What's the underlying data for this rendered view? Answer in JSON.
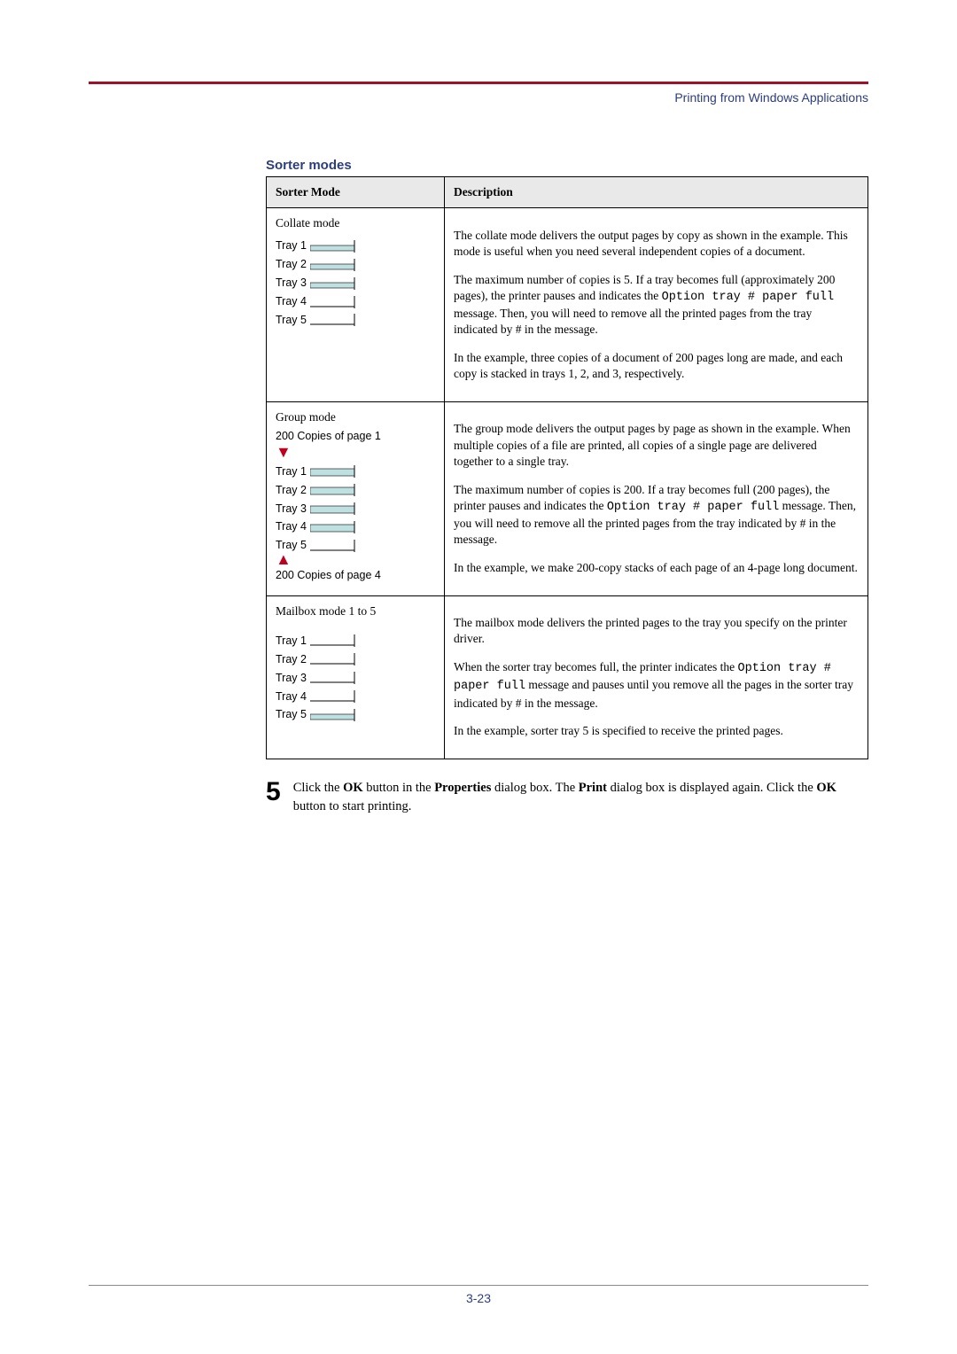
{
  "running_head": "Printing from Windows Applications",
  "section_title": "Sorter modes",
  "table": {
    "head": {
      "mode": "Sorter Mode",
      "desc": "Description"
    },
    "rows": [
      {
        "mode_title": "Collate mode",
        "trays": [
          "Tray 1",
          "Tray 2",
          "Tray 3",
          "Tray 4",
          "Tray 5"
        ],
        "desc": {
          "p1": "The collate mode delivers the output pages by copy as shown in the example. This mode is useful when you need several independent copies of a document.",
          "p2a": "The maximum number of copies is 5. If a tray becomes full (approximately 200 pages), the printer pauses and indicates the ",
          "p2code": "Option tray # paper full",
          "p2b": " message. Then, you will need to remove all the printed pages from the tray indicated by # in the message.",
          "p3": "In the example, three copies of a document of 200 pages long are made, and each copy is stacked in trays 1, 2, and 3, respectively."
        }
      },
      {
        "mode_title": "Group mode",
        "caption_top": "200 Copies of page 1",
        "caption_bot": "200 Copies of page 4",
        "trays": [
          "Tray 1",
          "Tray 2",
          "Tray 3",
          "Tray 4",
          "Tray 5"
        ],
        "desc": {
          "p1": "The group mode delivers the output pages by page as shown in the example. When multiple copies of a file are printed, all copies of a single page are delivered together to a single tray.",
          "p2a": "The maximum number of copies is 200. If a tray becomes full (200 pages), the printer pauses and indicates the ",
          "p2code": "Option tray # paper full",
          "p2b": " message. Then, you will need to remove all the printed pages from the tray indicated by # in the message.",
          "p3": "In the example, we make 200-copy stacks of each page of an 4-page long document."
        }
      },
      {
        "mode_title": "Mailbox mode 1 to 5",
        "trays": [
          "Tray 1",
          "Tray 2",
          "Tray 3",
          "Tray 4",
          "Tray 5"
        ],
        "desc": {
          "p1": "The mailbox mode delivers the printed pages to the tray you specify on the printer driver.",
          "p2a": "When the sorter tray becomes full, the printer indicates the ",
          "p2code": "Option tray # paper full",
          "p2b": " message and pauses until you remove all the pages in the sorter tray indicated by # in the message.",
          "p3": "In the example, sorter tray 5 is specified to receive the printed pages."
        }
      }
    ]
  },
  "step": {
    "num": "5",
    "t1": "Click the ",
    "b1": "OK",
    "t2": " button in the ",
    "b2": "Properties",
    "t3": " dialog box. The ",
    "b3": "Print",
    "t4": " dialog box is displayed again. Click the ",
    "b4": "OK",
    "t5": " button to start printing."
  },
  "page_num": "3-23"
}
